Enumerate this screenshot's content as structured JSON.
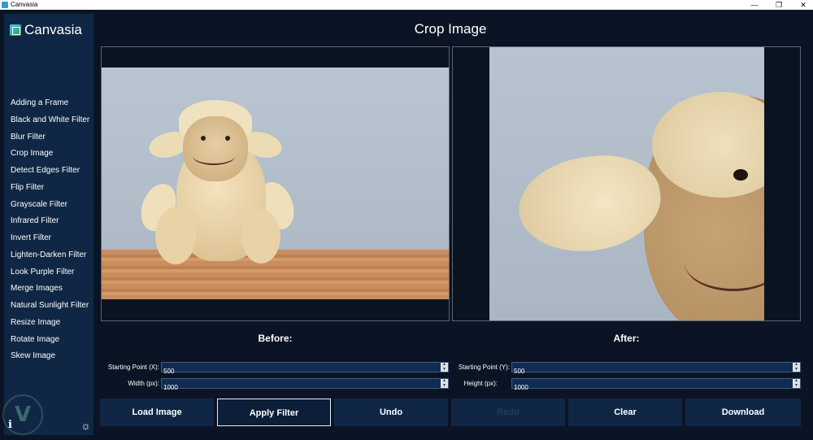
{
  "window": {
    "title": "Canvasia",
    "minimize_glyph": "—",
    "maximize_glyph": "❐",
    "close_glyph": "✕"
  },
  "sidebar": {
    "brand": "Canvasia",
    "items": [
      {
        "label": "Adding a Frame"
      },
      {
        "label": "Black and White Filter"
      },
      {
        "label": "Blur Filter"
      },
      {
        "label": "Crop Image"
      },
      {
        "label": "Detect Edges Filter"
      },
      {
        "label": "Flip Filter"
      },
      {
        "label": "Grayscale Filter"
      },
      {
        "label": "Infrared Filter"
      },
      {
        "label": "Invert Filter"
      },
      {
        "label": "Lighten-Darken Filter"
      },
      {
        "label": "Look Purple Filter"
      },
      {
        "label": "Merge Images"
      },
      {
        "label": "Natural Sunlight Filter"
      },
      {
        "label": "Resize Image"
      },
      {
        "label": "Rotate Image"
      },
      {
        "label": "Skew Image"
      }
    ],
    "info_icon": "i",
    "settings_icon": "☼"
  },
  "main": {
    "title": "Crop Image",
    "before_caption": "Before:",
    "after_caption": "After:"
  },
  "fields": {
    "start_x": {
      "label": "Starting Point (X):",
      "value": "500"
    },
    "start_y": {
      "label": "Starting Point (Y):",
      "value": "500"
    },
    "width": {
      "label": "Width (px):",
      "value": "1000"
    },
    "height": {
      "label": "Height (px):",
      "value": "1000"
    },
    "spin_up": "▲",
    "spin_down": "▼"
  },
  "buttons": {
    "load": "Load Image",
    "apply": "Apply Filter",
    "undo": "Undo",
    "redo": "Redo",
    "clear": "Clear",
    "download": "Download"
  },
  "colors": {
    "background": "#0b1424",
    "sidebar": "#0f2745",
    "button": "#0f2745",
    "field": "#122b52"
  }
}
